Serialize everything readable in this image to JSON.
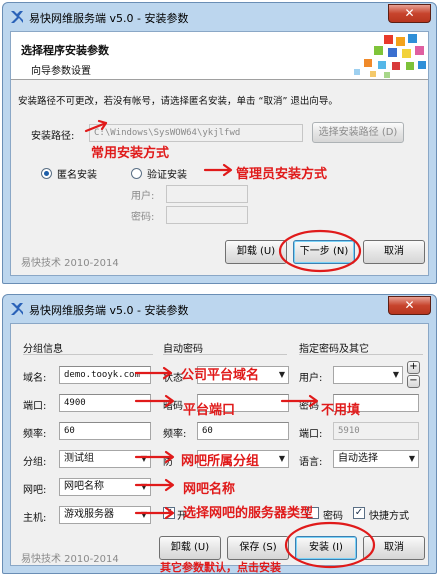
{
  "colors": {
    "annotation": "#e01a1a",
    "accent": "#1d5ea8"
  },
  "window1": {
    "title": "易快网维服务端 v5.0 - 安装参数",
    "close": "✕",
    "banner_title": "选择程序安装参数",
    "banner_sub": "向导参数设置",
    "instruction": "安装路径不可更改，若没有帐号，请选择匿名安装，单击 “取消” 退出向导。",
    "path_label": "安装路径:",
    "path_value": "C:\\Windows\\SysWOW64\\ykjlfwd",
    "choose_path_button": "选择安装路径 (D)",
    "radio_anonymous": "匿名安装",
    "radio_verify": "验证安装",
    "user_label": "用户:",
    "password_label": "密码:",
    "footer": "易快技术 2010-2014",
    "unload_button": "卸载 (U)",
    "next_button": "下一步 (N)",
    "cancel_button": "取消",
    "annotations": {
      "common": "常用安装方式",
      "admin": "管理员安装方式"
    }
  },
  "window2": {
    "title": "易快网维服务端 v5.0 - 安装参数",
    "close": "✕",
    "group_info": "分组信息",
    "group_auto_pwd": "自动密码",
    "group_pwd_other": "指定密码及其它",
    "domain_label": "域名:",
    "domain_value": "demo.tooyk.com",
    "port_label": "端口:",
    "port_value": "4900",
    "freq_label": "频率:",
    "freq_value": "60",
    "group_label": "分组:",
    "group_value": "测试组",
    "netbar_label": "网吧:",
    "netbar_value": "网吧名称",
    "host_label": "主机:",
    "host_value": "游戏服务器",
    "status_label": "状态",
    "cipher_label": "暗码",
    "freq2_label": "频率:",
    "freq2_value": "60",
    "prevent_label": "防",
    "user2_label": "用户:",
    "pwd2_label": "密码",
    "port2_label": "端口:",
    "port2_value": "5910",
    "lang_label": "语言:",
    "lang_value": "自动选择",
    "open_label": "开",
    "pwd_check_label": "密码",
    "shortcut_label": "快捷方式",
    "check_mark": "✓",
    "plus": "+",
    "minus": "−",
    "footer": "易快技术 2010-2014",
    "unload_button": "卸载 (U)",
    "save_button": "保存 (S)",
    "install_button": "安装 (I)",
    "cancel_button": "取消",
    "annotations": {
      "domain": "公司平台域名",
      "port": "平台端口",
      "no_fill": "不用填",
      "group": "网吧所属分组",
      "netbar": "网吧名称",
      "server_type": "选择网吧的服务器类型",
      "bottom": "其它参数默认，点击安装"
    }
  }
}
